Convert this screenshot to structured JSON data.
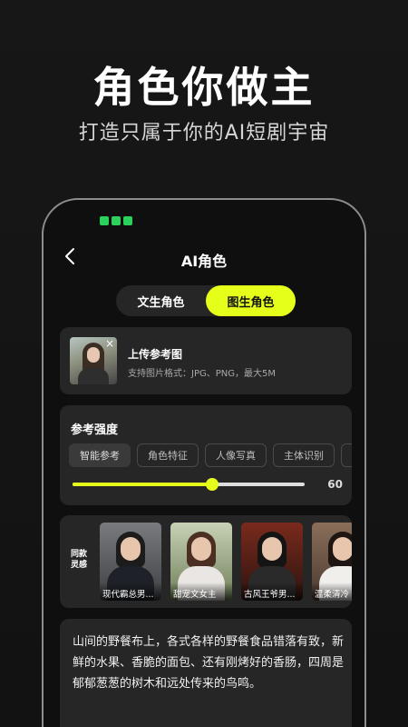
{
  "hero": {
    "title": "角色你做主",
    "subtitle": "打造只属于你的AI短剧宇宙"
  },
  "header": {
    "title": "AI角色"
  },
  "tabs": [
    {
      "label": "文生角色",
      "active": false
    },
    {
      "label": "图生角色",
      "active": true
    }
  ],
  "upload": {
    "title": "上传参考图",
    "hint": "支持图片格式：JPG、PNG，最大5M"
  },
  "strength": {
    "title": "参考强度",
    "options": [
      "智能参考",
      "角色特征",
      "人像写真",
      "主体识别",
      ""
    ],
    "selected": "智能参考",
    "value": 60,
    "value_label": "60"
  },
  "similar": {
    "label": "同款灵感",
    "cards": [
      {
        "caption": "现代霸总男..."
      },
      {
        "caption": "甜宠文女主"
      },
      {
        "caption": "古风王爷男..."
      },
      {
        "caption": "温柔清冷"
      }
    ]
  },
  "prompt": {
    "text": "山间的野餐布上，各式各样的野餐食品错落有致，新鲜的水果、香脆的面包、还有刚烤好的香肠，四周是郁郁葱葱的树木和远处传来的鸟鸣。"
  },
  "colors": {
    "accent": "#e6ff1a",
    "background": "#121212",
    "card": "#262626"
  }
}
